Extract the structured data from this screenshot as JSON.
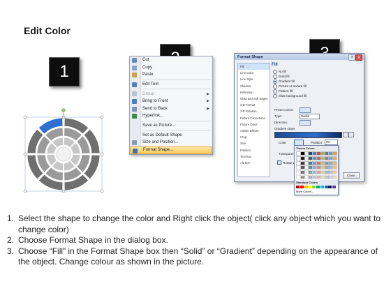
{
  "page_title": "Edit Color",
  "steps": [
    "1",
    "2",
    "3"
  ],
  "context_menu": {
    "items": [
      {
        "label": "Cut",
        "icon": "scissors-icon",
        "enabled": true,
        "submenu": false
      },
      {
        "label": "Copy",
        "icon": "copy-icon",
        "enabled": true,
        "submenu": false
      },
      {
        "label": "Paste",
        "icon": "paste-icon",
        "enabled": true,
        "submenu": false
      },
      {
        "label": "Edit Text",
        "icon": "edit-text-icon",
        "enabled": true,
        "submenu": false
      },
      {
        "label": "Group",
        "icon": "group-icon",
        "enabled": false,
        "submenu": true
      },
      {
        "label": "Bring to Front",
        "icon": "bring-front-icon",
        "enabled": true,
        "submenu": true
      },
      {
        "label": "Send to Back",
        "icon": "send-back-icon",
        "enabled": true,
        "submenu": true
      },
      {
        "label": "Hyperlink...",
        "icon": "hyperlink-icon",
        "enabled": true,
        "submenu": false
      },
      {
        "label": "Save as Picture...",
        "icon": "",
        "enabled": true,
        "submenu": false
      },
      {
        "label": "Set as Default Shape",
        "icon": "",
        "enabled": true,
        "submenu": false
      },
      {
        "label": "Size and Position...",
        "icon": "size-icon",
        "enabled": true,
        "submenu": false
      },
      {
        "label": "Format Shape...",
        "icon": "format-shape-icon",
        "enabled": true,
        "submenu": false,
        "highlighted": true
      }
    ]
  },
  "dialog": {
    "title": "Format Shape",
    "nav": [
      "Fill",
      "Line Color",
      "Line Style",
      "Shadow",
      "Reflection",
      "Glow and Soft Edges",
      "3-D Format",
      "3-D Rotation",
      "Picture Corrections",
      "Picture Color",
      "Artistic Effects",
      "Crop",
      "Size",
      "Position",
      "Text Box",
      "Alt Text"
    ],
    "section": "Fill",
    "fill_options": [
      "No fill",
      "Solid fill",
      "Gradient fill",
      "Picture or texture fill",
      "Pattern fill",
      "Slide background fill"
    ],
    "preset_label": "Preset colors:",
    "type_label": "Type:",
    "type_value": "Radial",
    "direction_label": "Direction:",
    "gradient_stops_label": "Gradient stops",
    "color_label": "Color",
    "position_label": "Position:",
    "position_value": "0%",
    "transparency_label": "Transparency",
    "rotate_label": "Rotate with shape",
    "theme_colors_label": "Theme Colors",
    "standard_colors_label": "Standard Colors",
    "more_colors_label": "More Colors...",
    "close_label": "Close"
  },
  "instructions": [
    {
      "num": "1.",
      "text": "Select the shape to change the color and Right click the object( click any object which you want to change color)"
    },
    {
      "num": "2.",
      "text": "Choose Format Shape in the dialog box."
    },
    {
      "num": "3.",
      "text": "Choose “Fill” in the Format Shape box then “Solid” or “Gradient” depending on the appearance of the object. Change colour as shown in the picture."
    }
  ],
  "colors": {
    "accent": "#2f6fcf",
    "step_box": "#0e0e0e",
    "menu_highlight": "#f8c95c"
  }
}
